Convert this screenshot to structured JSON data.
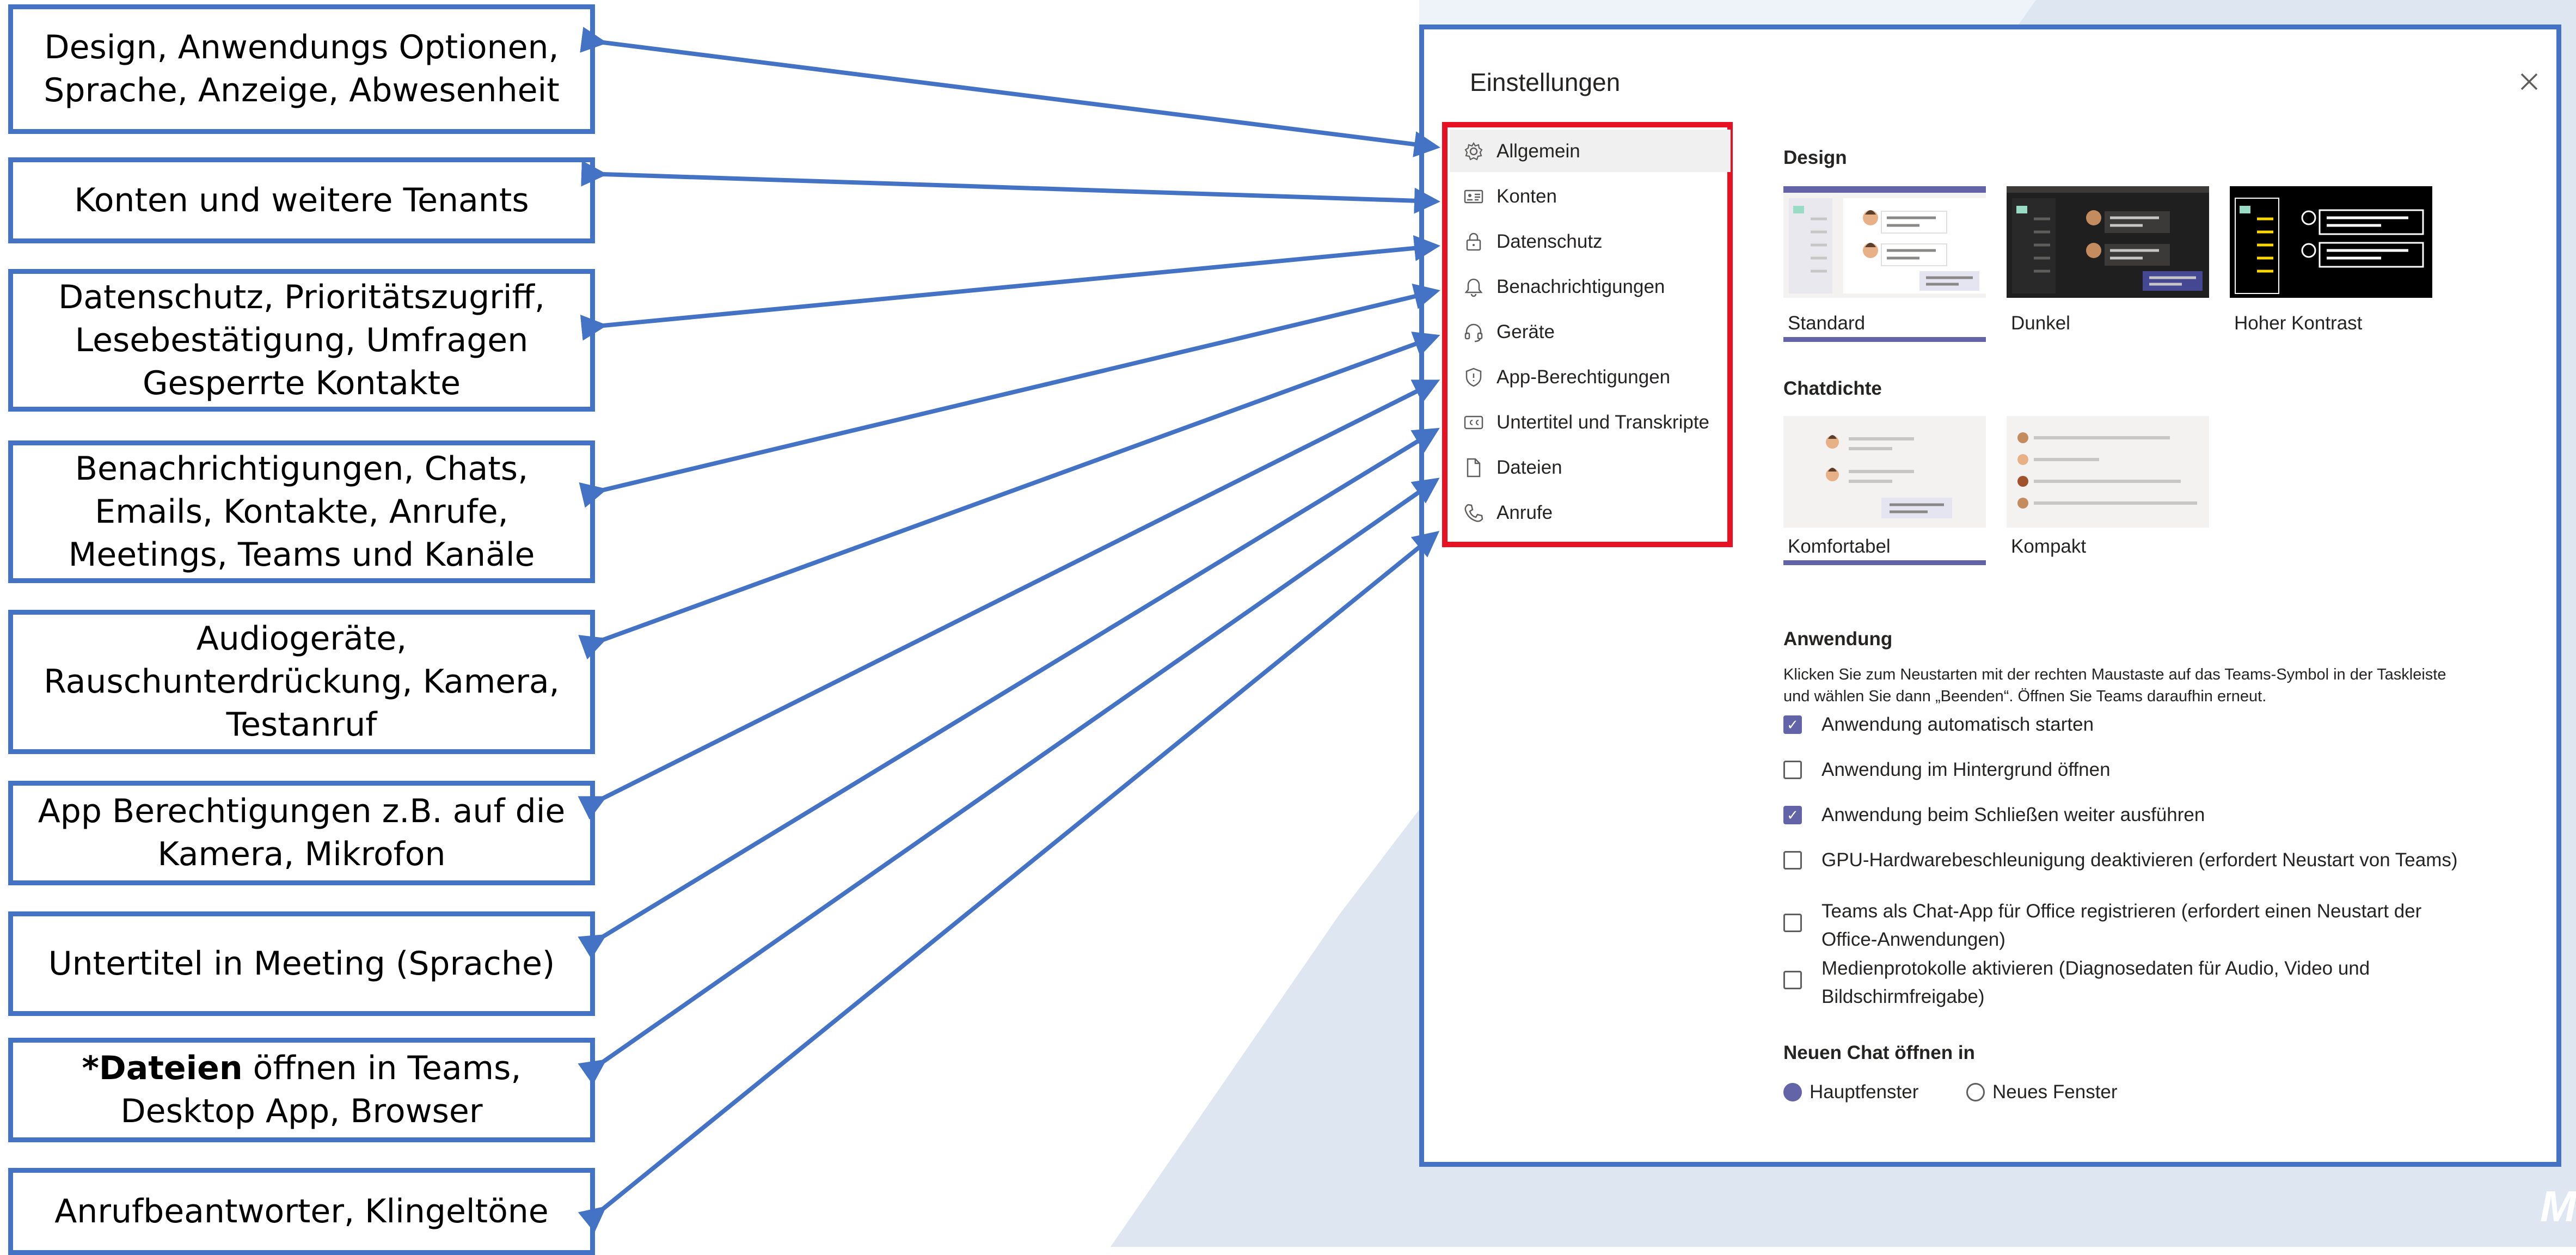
{
  "callouts": [
    {
      "lines": [
        "Design, Anwendungs Optionen,",
        "Sprache, Anzeige, Abwesenheit"
      ]
    },
    {
      "lines": [
        "Konten und weitere Tenants"
      ]
    },
    {
      "lines": [
        "Datenschutz, Prioritätszugriff,",
        "Lesebestätigung, Umfragen",
        "Gesperrte Kontakte"
      ]
    },
    {
      "lines": [
        "Benachrichtigungen, Chats,",
        "Emails, Kontakte, Anrufe,",
        "Meetings, Teams und Kanäle"
      ]
    },
    {
      "lines": [
        "Audiogeräte,",
        "Rauschunterdrückung, Kamera,",
        "Testanruf"
      ]
    },
    {
      "lines": [
        "App Berechtigungen z.B. auf die",
        "Kamera, Mikrofon"
      ]
    },
    {
      "lines": [
        "Untertitel in Meeting (Sprache)"
      ]
    },
    {
      "bold_prefix": "*Dateien",
      "rest": " öffnen in Teams,",
      "line2": "Desktop App, Browser"
    },
    {
      "lines": [
        "Anrufbeantworter, Klingeltöne"
      ]
    }
  ],
  "dialog": {
    "title": "Einstellungen",
    "nav": [
      {
        "label": "Allgemein",
        "icon": "gear-icon",
        "selected": true
      },
      {
        "label": "Konten",
        "icon": "id-card-icon"
      },
      {
        "label": "Datenschutz",
        "icon": "lock-icon"
      },
      {
        "label": "Benachrichtigungen",
        "icon": "bell-icon"
      },
      {
        "label": "Geräte",
        "icon": "headset-icon"
      },
      {
        "label": "App-Berechtigungen",
        "icon": "shield-icon"
      },
      {
        "label": "Untertitel und Transkripte",
        "icon": "cc-icon"
      },
      {
        "label": "Dateien",
        "icon": "file-icon"
      },
      {
        "label": "Anrufe",
        "icon": "phone-icon"
      }
    ],
    "design": {
      "heading": "Design",
      "themes": [
        {
          "label": "Standard",
          "selected": true
        },
        {
          "label": "Dunkel"
        },
        {
          "label": "Hoher Kontrast"
        }
      ]
    },
    "density": {
      "heading": "Chatdichte",
      "options": [
        {
          "label": "Komfortabel",
          "selected": true
        },
        {
          "label": "Kompakt"
        }
      ]
    },
    "application": {
      "heading": "Anwendung",
      "desc_line1": "Klicken Sie zum Neustarten mit der rechten Maustaste auf das Teams-Symbol in der Taskleiste",
      "desc_line2": "und wählen Sie dann „Beenden“. Öffnen Sie Teams daraufhin erneut.",
      "options": [
        {
          "lines": [
            "Anwendung automatisch starten"
          ],
          "checked": true
        },
        {
          "lines": [
            "Anwendung im Hintergrund öffnen"
          ],
          "checked": false
        },
        {
          "lines": [
            "Anwendung beim Schließen weiter ausführen"
          ],
          "checked": true
        },
        {
          "lines": [
            "GPU-Hardwarebeschleunigung deaktivieren (erfordert Neustart von Teams)"
          ],
          "checked": false
        },
        {
          "lines": [
            "Teams als Chat-App für Office registrieren (erfordert einen Neustart der",
            "Office-Anwendungen)"
          ],
          "checked": false
        },
        {
          "lines": [
            "Medienprotokolle aktivieren (Diagnosedaten für Audio, Video und",
            "Bildschirmfreigabe)"
          ],
          "checked": false
        }
      ]
    },
    "new_chat": {
      "heading": "Neuen Chat öffnen in",
      "options": [
        {
          "label": "Hauptfenster",
          "selected": true
        },
        {
          "label": "Neues Fenster",
          "selected": false
        }
      ]
    }
  },
  "colors": {
    "accent": "#6264A7",
    "callout_border": "#4472C4",
    "highlight": "#E81123",
    "background_shape": "#DEE6F2"
  }
}
